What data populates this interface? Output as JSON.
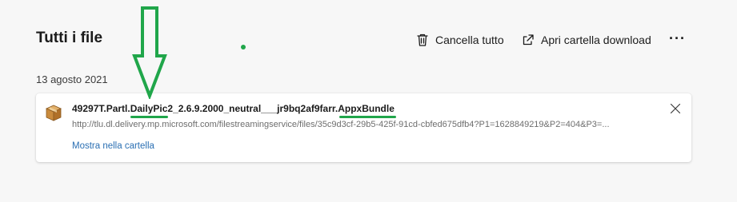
{
  "header": {
    "title": "Tutti i file",
    "clear_label": "Cancella tutto",
    "open_folder_label": "Apri cartella download",
    "more_label": "···"
  },
  "downloads": {
    "date": "13 agosto 2021",
    "items": [
      {
        "name": "49297T.Partl.DailyPic2_2.6.9.2000_neutral___jr9bq2af9farr.AppxBundle",
        "url": "http://tlu.dl.delivery.mp.microsoft.com/filestreamingservice/files/35c9d3cf-29b5-425f-91cd-cbfed675dfb4?P1=1628849219&P2=404&P3=...",
        "show_in_folder_label": "Mostra nella cartella",
        "icon": "package-box-icon"
      }
    ]
  },
  "annotation": {
    "color": "#20a64a",
    "type": "arrow-and-underlines"
  }
}
